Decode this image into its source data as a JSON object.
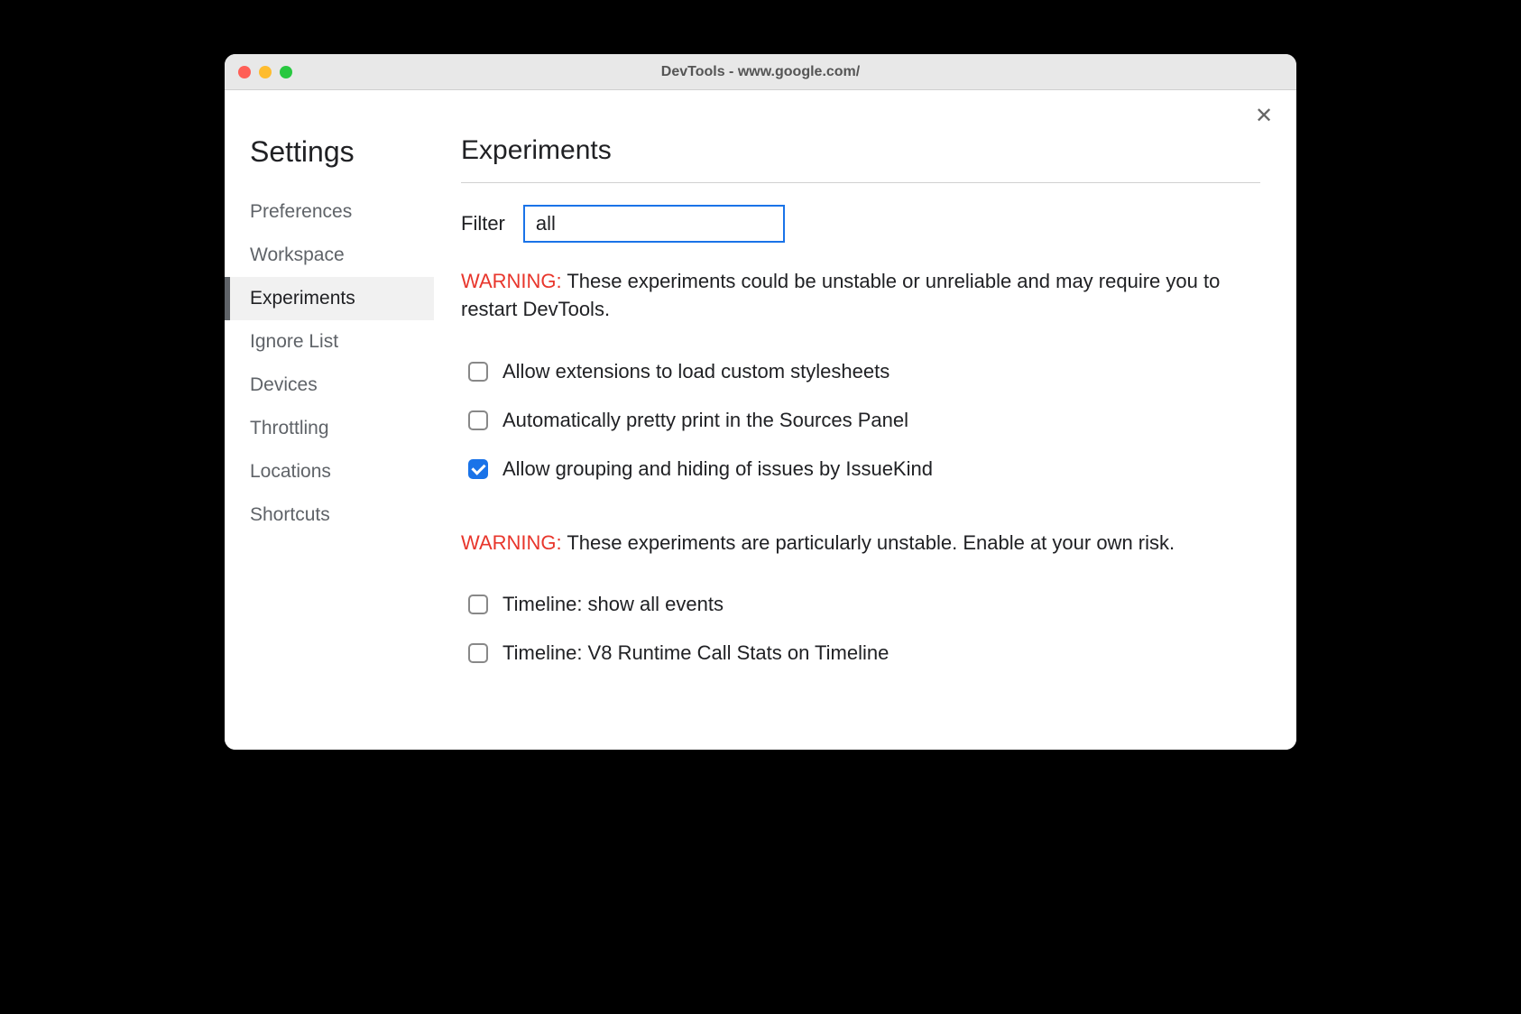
{
  "window": {
    "title": "DevTools - www.google.com/"
  },
  "sidebar": {
    "title": "Settings",
    "items": [
      {
        "label": "Preferences",
        "active": false
      },
      {
        "label": "Workspace",
        "active": false
      },
      {
        "label": "Experiments",
        "active": true
      },
      {
        "label": "Ignore List",
        "active": false
      },
      {
        "label": "Devices",
        "active": false
      },
      {
        "label": "Throttling",
        "active": false
      },
      {
        "label": "Locations",
        "active": false
      },
      {
        "label": "Shortcuts",
        "active": false
      }
    ]
  },
  "main": {
    "title": "Experiments",
    "filter": {
      "label": "Filter",
      "value": "all"
    },
    "warning1": {
      "label": "WARNING:",
      "text": " These experiments could be unstable or unreliable and may require you to restart DevTools."
    },
    "group1": [
      {
        "label": "Allow extensions to load custom stylesheets",
        "checked": false
      },
      {
        "label": "Automatically pretty print in the Sources Panel",
        "checked": false
      },
      {
        "label": "Allow grouping and hiding of issues by IssueKind",
        "checked": true
      }
    ],
    "warning2": {
      "label": "WARNING:",
      "text": " These experiments are particularly unstable. Enable at your own risk."
    },
    "group2": [
      {
        "label": "Timeline: show all events",
        "checked": false
      },
      {
        "label": "Timeline: V8 Runtime Call Stats on Timeline",
        "checked": false
      }
    ]
  }
}
